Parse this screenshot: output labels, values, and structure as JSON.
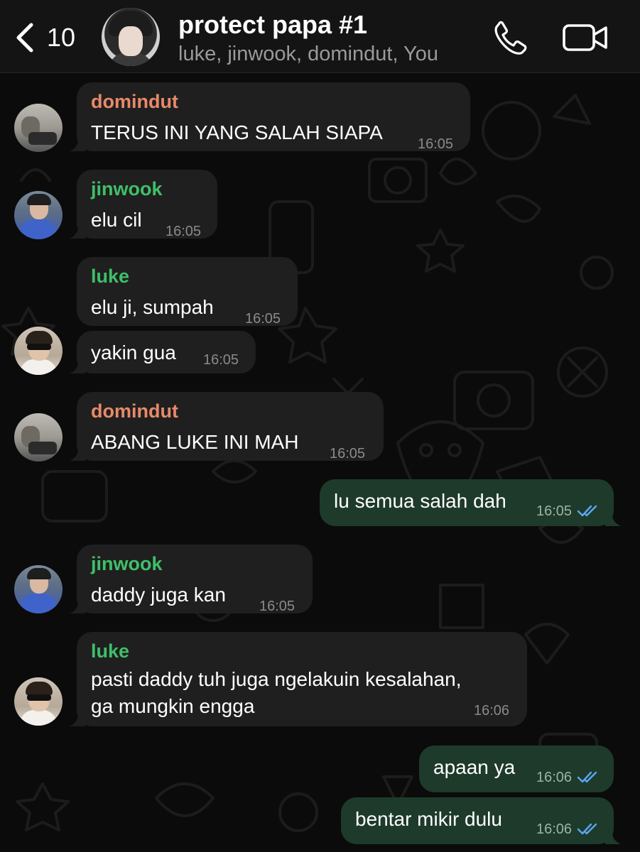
{
  "header": {
    "back_count": "10",
    "group_name": "protect papa #1",
    "members": "luke, jinwook, domindut, You"
  },
  "colors": {
    "domindut": "#e8896a",
    "jinwook": "#3fbf6a",
    "luke": "#3fbf6a",
    "incoming_bubble": "#1f1f1f",
    "outgoing_bubble": "#1e3a2b",
    "read_ticks": "#5aa7f2"
  },
  "icons": {
    "back": "chevron-left-icon",
    "call": "phone-icon",
    "video": "video-camera-icon",
    "read": "double-check-icon"
  },
  "messages": [
    {
      "sender": "domindut",
      "text": "TERUS INI YANG SALAH SIAPA",
      "time": "16:05"
    },
    {
      "sender": "jinwook",
      "text": "elu cil",
      "time": "16:05"
    },
    {
      "sender": "luke",
      "text": "elu ji, sumpah",
      "time": "16:05"
    },
    {
      "sender": "",
      "text": "yakin gua",
      "time": "16:05"
    },
    {
      "sender": "domindut",
      "text": "ABANG LUKE INI MAH",
      "time": "16:05"
    },
    {
      "sender": "You",
      "text": "lu semua salah dah",
      "time": "16:05"
    },
    {
      "sender": "jinwook",
      "text": "daddy juga kan",
      "time": "16:05"
    },
    {
      "sender": "luke",
      "text": "pasti daddy tuh juga ngelakuin kesalahan,\nga mungkin engga",
      "time": "16:06"
    },
    {
      "sender": "You",
      "text": "apaan ya",
      "time": "16:06"
    },
    {
      "sender": "You",
      "text": "bentar mikir dulu",
      "time": "16:06"
    }
  ]
}
